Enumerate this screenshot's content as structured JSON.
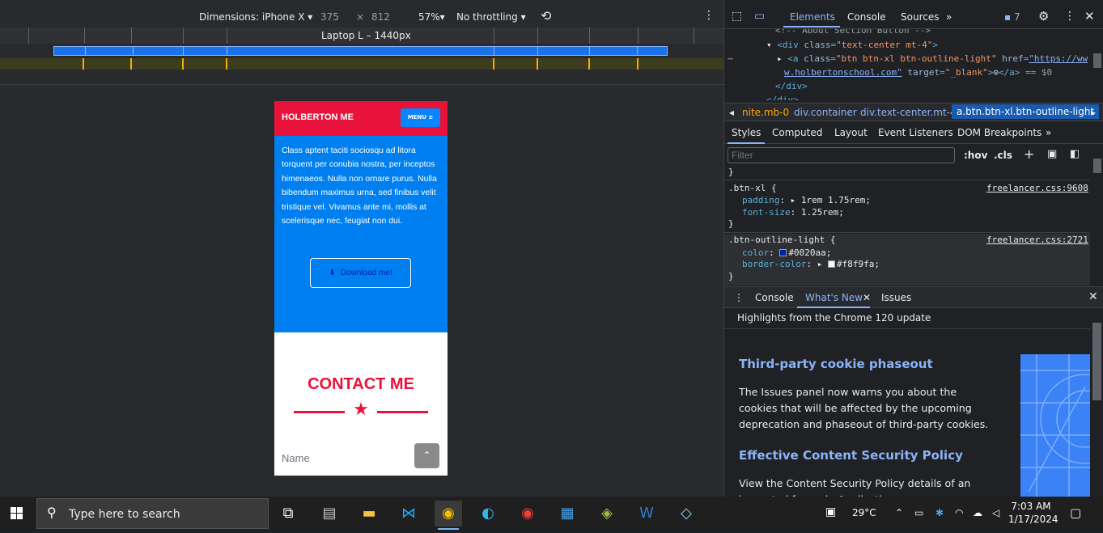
{
  "emulation": {
    "dimensions_label": "Dimensions: iPhone X",
    "width": "375",
    "times": "×",
    "height": "812",
    "zoom": "57%",
    "throttling": "No throttling",
    "media_query_label": "Laptop L – 1440px"
  },
  "phone": {
    "brand": "HOLBERTON ME",
    "menu_label": "MENU",
    "about_text": "Class aptent taciti sociosqu ad litora torquent per conubia nostra, per inceptos himenaeos. Nulla non ornare purus. Nulla bibendum maximus urna, sed finibus velit tristique vel. Vivamus ante mi, mollis at scelerisque nec, feugiat non dui.",
    "download_label": "Download me!",
    "contact_title": "CONTACT ME",
    "name_placeholder": "Name"
  },
  "devtools": {
    "tabs": [
      "Elements",
      "Console",
      "Sources"
    ],
    "issues_count": "7",
    "dom": {
      "comment": "<!-- About Section Button -->",
      "div_open": "div",
      "div_class_attr": "class",
      "div_class_val": "\"text-center mt-4\"",
      "a_tag": "a",
      "a_class_attr": "class",
      "a_class_val": "\"btn btn-xl btn-outline-light\"",
      "a_href_attr": "href",
      "a_href_val_1": "\"https://ww",
      "a_href_val_2": "w.holbertonschool.com\"",
      "a_target_attr": "target",
      "a_target_val": "\"_blank\"",
      "a_close": "</a>",
      "eq": "== $0",
      "div_close": "</div>",
      "div_close_2": "</div>"
    },
    "breadcrumbs": [
      "nite.mb-0",
      "div.container",
      "div.text-center.mt-4",
      "a.btn.btn-xl.btn-outline-light"
    ],
    "subtabs": [
      "Styles",
      "Computed",
      "Layout",
      "Event Listeners",
      "DOM Breakpoints"
    ],
    "filter_placeholder": "Filter",
    "hov": ":hov",
    "cls": ".cls",
    "styles": {
      "brace_close": "}",
      "rule1_selector": ".btn-xl {",
      "rule1_source": "freelancer.css:9608",
      "rule1_p1_name": "padding",
      "rule1_p1_val": "1rem 1.75rem;",
      "rule1_p2_name": "font-size",
      "rule1_p2_val": "1.25rem;",
      "rule2_selector": ".btn-outline-light {",
      "rule2_source": "freelancer.css:2721",
      "rule2_p1_name": "color",
      "rule2_p1_val": "#0020aa;",
      "rule2_p2_name": "border-color",
      "rule2_p2_val": "#f8f9fa;"
    },
    "drawer_tabs": [
      "Console",
      "What's New",
      "Issues"
    ],
    "whats_new": {
      "title": "Highlights from the Chrome 120 update",
      "h1": "Third-party cookie phaseout",
      "p1": "The Issues panel now warns you about the cookies that will be affected by the upcoming deprecation and phaseout of third-party cookies.",
      "h2": "Effective Content Security Policy",
      "p2": "View the Content Security Policy details of an inspected frame in Application"
    }
  },
  "taskbar": {
    "search_placeholder": "Type here to search",
    "temperature": "29°C",
    "time": "7:03 AM",
    "date": "1/17/2024"
  },
  "colors": {
    "phone_nav": "#e8133a",
    "phone_about": "#0080f0",
    "devtools_accent": "#8ab4f8"
  }
}
